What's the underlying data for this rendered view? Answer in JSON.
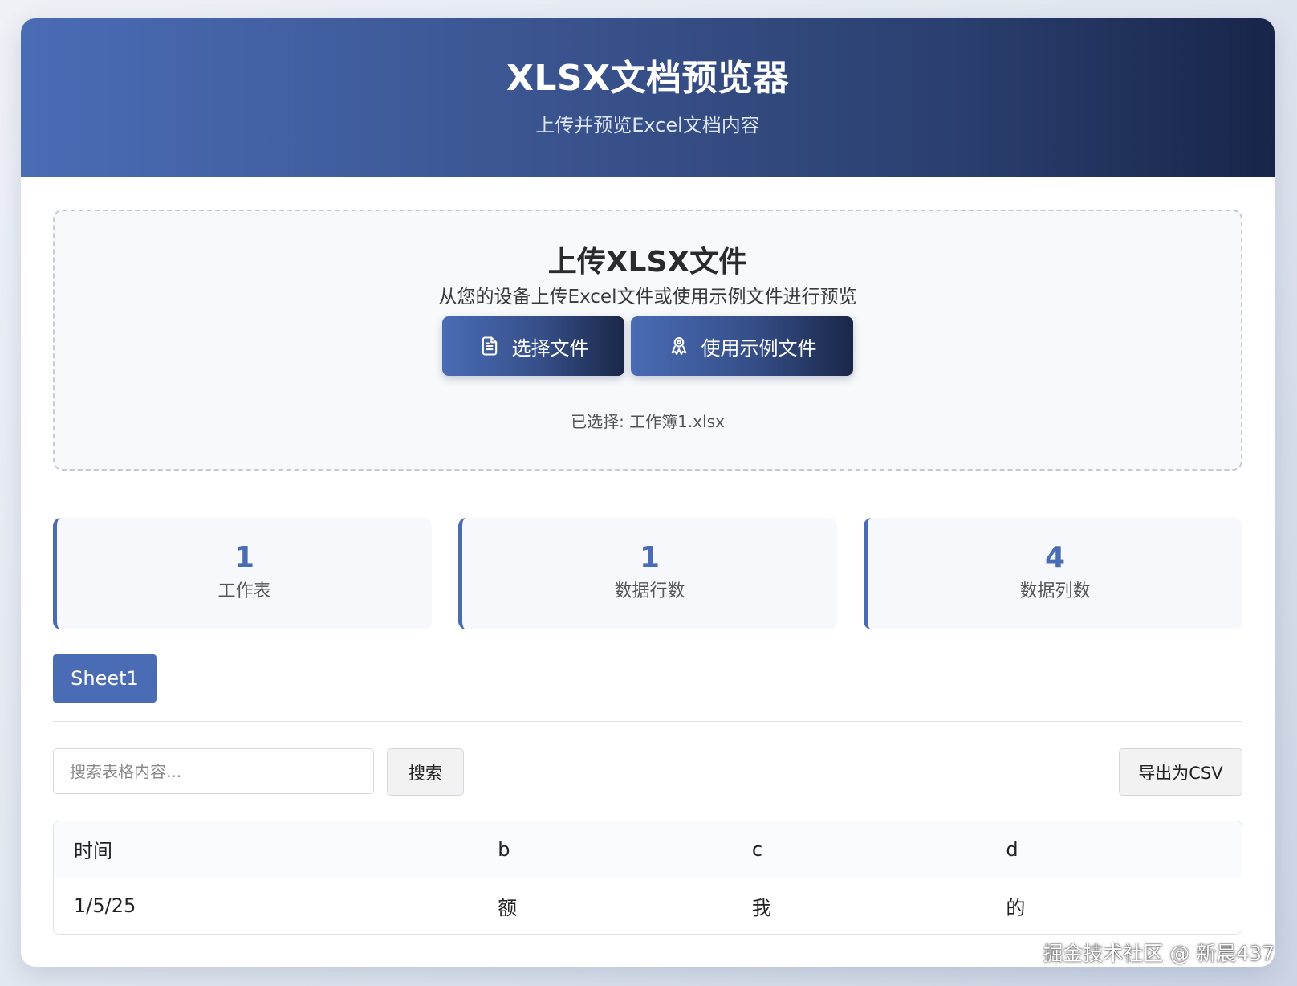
{
  "header": {
    "title": "XLSX文档预览器",
    "subtitle": "上传并预览Excel文档内容"
  },
  "upload": {
    "title": "上传XLSX文件",
    "description": "从您的设备上传Excel文件或使用示例文件进行预览",
    "select_button": "选择文件",
    "sample_button": "使用示例文件",
    "selected_text": "已选择: 工作簿1.xlsx"
  },
  "stats": [
    {
      "value": "1",
      "label": "工作表"
    },
    {
      "value": "1",
      "label": "数据行数"
    },
    {
      "value": "4",
      "label": "数据列数"
    }
  ],
  "sheet_tab": "Sheet1",
  "toolbar": {
    "search_placeholder": "搜索表格内容...",
    "search_button": "搜索",
    "export_button": "导出为CSV"
  },
  "table": {
    "headers": [
      "时间",
      "b",
      "c",
      "d"
    ],
    "rows": [
      [
        "1/5/25",
        "额",
        "我",
        "的"
      ]
    ]
  },
  "watermark": "掘金技术社区 @ 新晨437",
  "colors": {
    "accent": "#4a6cb5",
    "header_dark": "#18254a"
  },
  "icons": {
    "select_button_icon": "document-icon",
    "sample_button_icon": "sample-icon"
  }
}
